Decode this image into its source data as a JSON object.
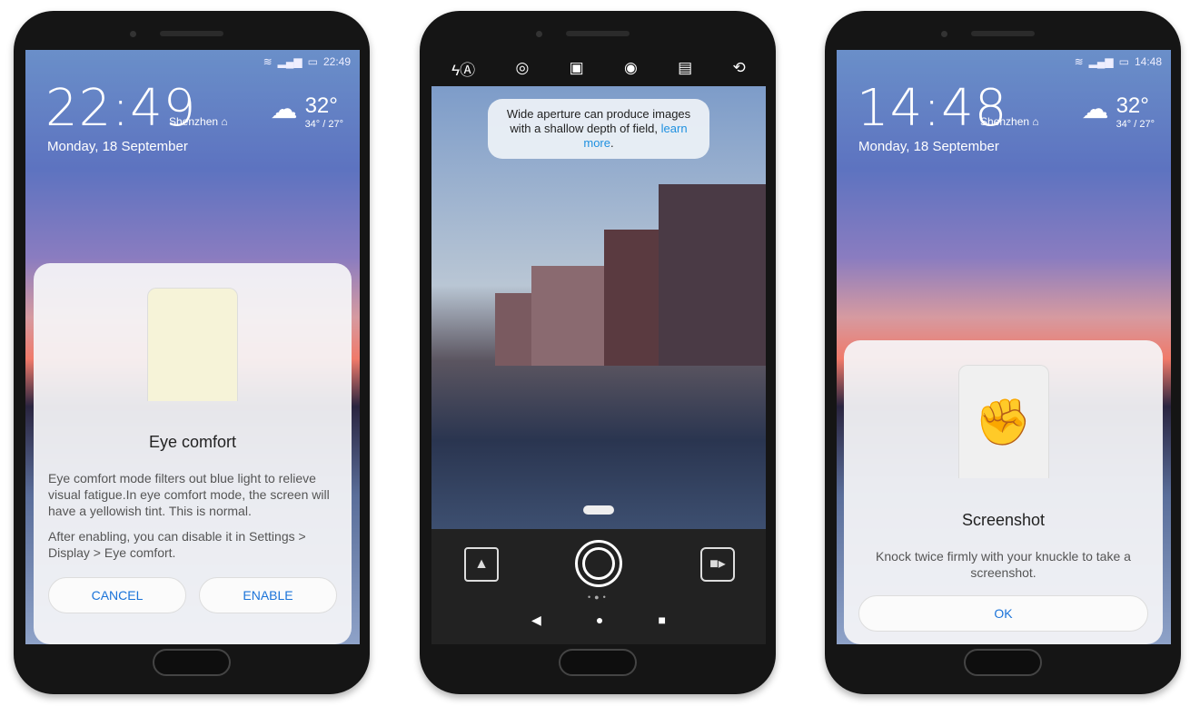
{
  "phone1": {
    "status_time": "22:49",
    "clock": "22:49",
    "city": "Shenzhen",
    "date": "Monday, 18 September",
    "temp": "32°",
    "range": "34° / 27°",
    "dialog": {
      "title": "Eye comfort",
      "body1": "Eye comfort mode filters out blue light to relieve visual fatigue.In eye comfort mode, the screen will have a yellowish tint. This is normal.",
      "body2": "After enabling, you can disable it in Settings > Display > Eye comfort.",
      "cancel": "CANCEL",
      "enable": "ENABLE"
    }
  },
  "phone2": {
    "toolbar": [
      "flash-auto-icon",
      "aperture-icon",
      "portrait-icon",
      "live-photo-icon",
      "filter-icon",
      "switch-camera-icon"
    ],
    "tip": {
      "text": "Wide aperture can produce images with a shallow depth of field, ",
      "link": "learn more",
      "end": "."
    },
    "mode_page": 2,
    "mode_pages": 3
  },
  "phone3": {
    "status_time": "14:48",
    "clock": "14:48",
    "city": "Shenzhen",
    "date": "Monday, 18 September",
    "temp": "32°",
    "range": "34° / 27°",
    "dialog": {
      "title": "Screenshot",
      "body": "Knock twice firmly with your knuckle to take a screenshot.",
      "ok": "OK"
    }
  },
  "colors": {
    "accent": "#1a73d9",
    "link": "#1e90e0"
  }
}
